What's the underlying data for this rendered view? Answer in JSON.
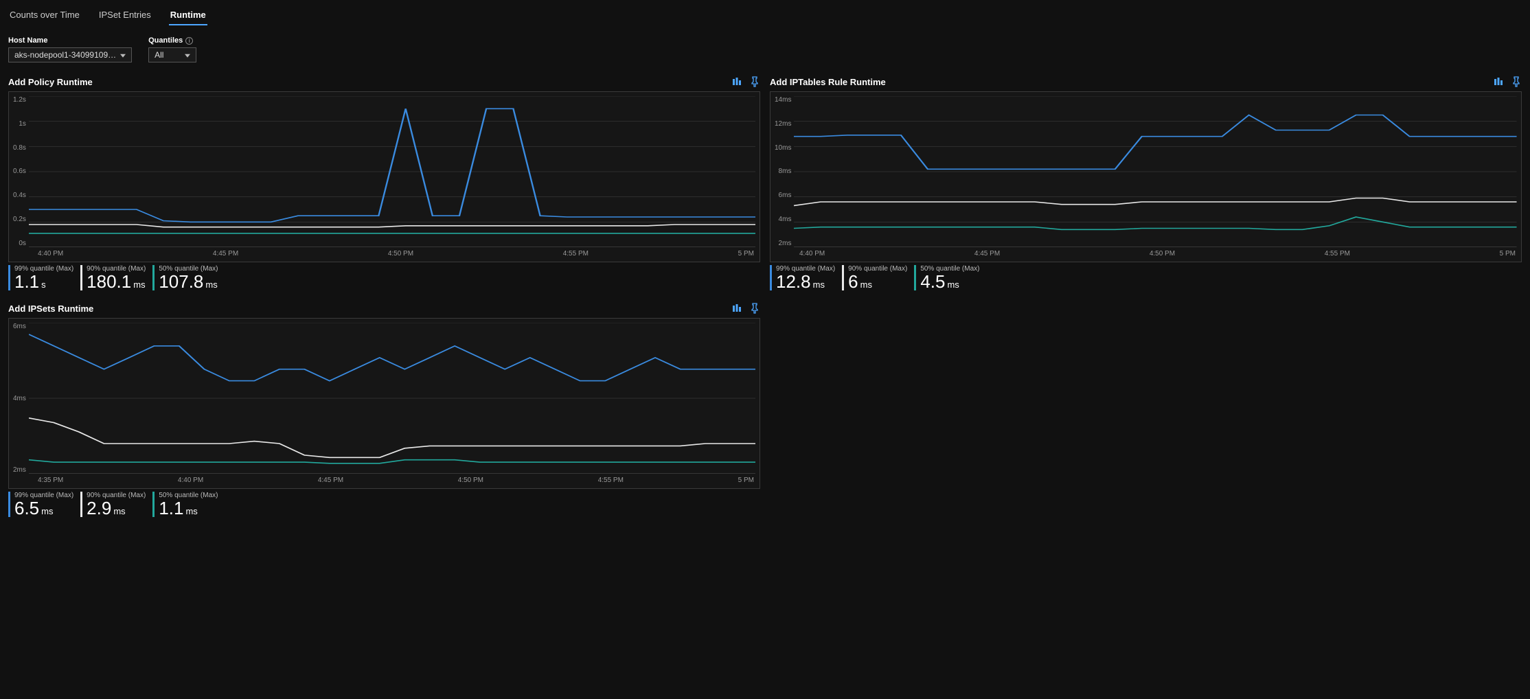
{
  "tabs": {
    "counts": "Counts over Time",
    "ipset": "IPSet Entries",
    "runtime": "Runtime"
  },
  "filters": {
    "hostname_label": "Host Name",
    "hostname_value": "aks-nodepool1-34099109…",
    "quantiles_label": "Quantiles",
    "quantiles_value": "All"
  },
  "colors": {
    "q99": "#3a8be0",
    "q90": "#e8e8e8",
    "q50": "#22a89c"
  },
  "panels": [
    {
      "id": "policy",
      "title": "Add Policy Runtime",
      "legend": [
        {
          "label": "99% quantile (Max)",
          "value": "1.1",
          "unit": "s",
          "color": "q99"
        },
        {
          "label": "90% quantile (Max)",
          "value": "180.1",
          "unit": "ms",
          "color": "q90"
        },
        {
          "label": "50% quantile (Max)",
          "value": "107.8",
          "unit": "ms",
          "color": "q50"
        }
      ]
    },
    {
      "id": "iptables",
      "title": "Add IPTables Rule Runtime",
      "legend": [
        {
          "label": "99% quantile (Max)",
          "value": "12.8",
          "unit": "ms",
          "color": "q99"
        },
        {
          "label": "90% quantile (Max)",
          "value": "6",
          "unit": "ms",
          "color": "q90"
        },
        {
          "label": "50% quantile (Max)",
          "value": "4.5",
          "unit": "ms",
          "color": "q50"
        }
      ]
    },
    {
      "id": "ipsets",
      "title": "Add IPSets Runtime",
      "legend": [
        {
          "label": "99% quantile (Max)",
          "value": "6.5",
          "unit": "ms",
          "color": "q99"
        },
        {
          "label": "90% quantile (Max)",
          "value": "2.9",
          "unit": "ms",
          "color": "q90"
        },
        {
          "label": "50% quantile (Max)",
          "value": "1.1",
          "unit": "ms",
          "color": "q50"
        }
      ]
    }
  ],
  "chart_data": [
    {
      "id": "policy",
      "type": "line",
      "title": "Add Policy Runtime",
      "xlabel": "",
      "ylabel": "",
      "y_ticks": [
        "1.2s",
        "1s",
        "0.8s",
        "0.6s",
        "0.4s",
        "0.2s",
        "0s"
      ],
      "x_ticks": [
        "4:40 PM",
        "4:45 PM",
        "4:50 PM",
        "4:55 PM",
        "5 PM"
      ],
      "ylim": [
        0,
        1.2
      ],
      "x": [
        0,
        1,
        2,
        3,
        4,
        5,
        6,
        7,
        8,
        9,
        10,
        11,
        12,
        13,
        14,
        15,
        16,
        17,
        18,
        19,
        20,
        21,
        22,
        23,
        24,
        25,
        26,
        27
      ],
      "series": [
        {
          "name": "99% quantile",
          "color": "q99",
          "values": [
            0.3,
            0.3,
            0.3,
            0.3,
            0.3,
            0.21,
            0.2,
            0.2,
            0.2,
            0.2,
            0.25,
            0.25,
            0.25,
            0.25,
            1.1,
            0.25,
            0.25,
            1.1,
            1.1,
            0.25,
            0.24,
            0.24,
            0.24,
            0.24,
            0.24,
            0.24,
            0.24,
            0.24
          ]
        },
        {
          "name": "90% quantile",
          "color": "q90",
          "values": [
            0.18,
            0.18,
            0.18,
            0.18,
            0.18,
            0.16,
            0.16,
            0.16,
            0.16,
            0.16,
            0.16,
            0.16,
            0.16,
            0.16,
            0.17,
            0.17,
            0.17,
            0.17,
            0.17,
            0.17,
            0.17,
            0.17,
            0.17,
            0.17,
            0.18,
            0.18,
            0.18,
            0.18
          ]
        },
        {
          "name": "50% quantile",
          "color": "q50",
          "values": [
            0.11,
            0.11,
            0.11,
            0.11,
            0.11,
            0.11,
            0.11,
            0.11,
            0.11,
            0.11,
            0.11,
            0.11,
            0.11,
            0.11,
            0.11,
            0.11,
            0.11,
            0.11,
            0.11,
            0.11,
            0.11,
            0.11,
            0.11,
            0.11,
            0.11,
            0.11,
            0.11,
            0.11
          ]
        }
      ]
    },
    {
      "id": "iptables",
      "type": "line",
      "title": "Add IPTables Rule Runtime",
      "xlabel": "",
      "ylabel": "",
      "y_ticks": [
        "14ms",
        "12ms",
        "10ms",
        "8ms",
        "6ms",
        "4ms",
        "2ms"
      ],
      "x_ticks": [
        "4:40 PM",
        "4:45 PM",
        "4:50 PM",
        "4:55 PM",
        "5 PM"
      ],
      "ylim": [
        2,
        14
      ],
      "x": [
        0,
        1,
        2,
        3,
        4,
        5,
        6,
        7,
        8,
        9,
        10,
        11,
        12,
        13,
        14,
        15,
        16,
        17,
        18,
        19,
        20,
        21,
        22,
        23,
        24,
        25,
        26,
        27
      ],
      "series": [
        {
          "name": "99% quantile",
          "color": "q99",
          "values": [
            10.8,
            10.8,
            10.9,
            10.9,
            10.9,
            8.2,
            8.2,
            8.2,
            8.2,
            8.2,
            8.2,
            8.2,
            8.2,
            10.8,
            10.8,
            10.8,
            10.8,
            12.5,
            11.3,
            11.3,
            11.3,
            12.5,
            12.5,
            10.8,
            10.8,
            10.8,
            10.8,
            10.8
          ]
        },
        {
          "name": "90% quantile",
          "color": "q90",
          "values": [
            5.3,
            5.6,
            5.6,
            5.6,
            5.6,
            5.6,
            5.6,
            5.6,
            5.6,
            5.6,
            5.4,
            5.4,
            5.4,
            5.6,
            5.6,
            5.6,
            5.6,
            5.6,
            5.6,
            5.6,
            5.6,
            5.9,
            5.9,
            5.6,
            5.6,
            5.6,
            5.6,
            5.6
          ]
        },
        {
          "name": "50% quantile",
          "color": "q50",
          "values": [
            3.5,
            3.6,
            3.6,
            3.6,
            3.6,
            3.6,
            3.6,
            3.6,
            3.6,
            3.6,
            3.4,
            3.4,
            3.4,
            3.5,
            3.5,
            3.5,
            3.5,
            3.5,
            3.4,
            3.4,
            3.7,
            4.4,
            4.0,
            3.6,
            3.6,
            3.6,
            3.6,
            3.6
          ]
        }
      ]
    },
    {
      "id": "ipsets",
      "type": "line",
      "title": "Add IPSets Runtime",
      "xlabel": "",
      "ylabel": "",
      "y_ticks": [
        "6ms",
        "4ms",
        "2ms"
      ],
      "x_ticks": [
        "4:35 PM",
        "4:40 PM",
        "4:45 PM",
        "4:50 PM",
        "4:55 PM",
        "5 PM"
      ],
      "ylim": [
        0.5,
        7
      ],
      "x": [
        0,
        1,
        2,
        3,
        4,
        5,
        6,
        7,
        8,
        9,
        10,
        11,
        12,
        13,
        14,
        15,
        16,
        17,
        18,
        19,
        20,
        21,
        22,
        23,
        24,
        25,
        26,
        27,
        28,
        29
      ],
      "series": [
        {
          "name": "99% quantile",
          "color": "q99",
          "values": [
            6.5,
            6.0,
            5.5,
            5.0,
            5.5,
            6.0,
            6.0,
            5.0,
            4.5,
            4.5,
            5.0,
            5.0,
            4.5,
            5.0,
            5.5,
            5.0,
            5.5,
            6.0,
            5.5,
            5.0,
            5.5,
            5.0,
            4.5,
            4.5,
            5.0,
            5.5,
            5.0,
            5.0,
            5.0,
            5.0
          ]
        },
        {
          "name": "90% quantile",
          "color": "q90",
          "values": [
            2.9,
            2.7,
            2.3,
            1.8,
            1.8,
            1.8,
            1.8,
            1.8,
            1.8,
            1.9,
            1.8,
            1.3,
            1.2,
            1.2,
            1.2,
            1.6,
            1.7,
            1.7,
            1.7,
            1.7,
            1.7,
            1.7,
            1.7,
            1.7,
            1.7,
            1.7,
            1.7,
            1.8,
            1.8,
            1.8
          ]
        },
        {
          "name": "50% quantile",
          "color": "q50",
          "values": [
            1.1,
            1.0,
            1.0,
            1.0,
            1.0,
            1.0,
            1.0,
            1.0,
            1.0,
            1.0,
            1.0,
            1.0,
            0.95,
            0.95,
            0.95,
            1.1,
            1.1,
            1.1,
            1.0,
            1.0,
            1.0,
            1.0,
            1.0,
            1.0,
            1.0,
            1.0,
            1.0,
            1.0,
            1.0,
            1.0
          ]
        }
      ]
    }
  ]
}
